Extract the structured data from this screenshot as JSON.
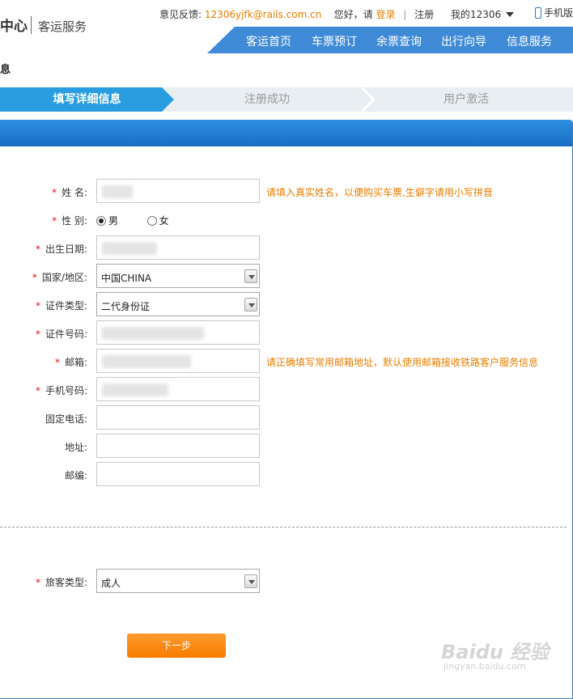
{
  "header": {
    "logo_fragment": "中心",
    "site_section": "客运服务",
    "feedback_label": "意见反馈:",
    "feedback_email": "12306yjfk@rails.com.cn",
    "greeting": "您好，请",
    "login": "登录",
    "separator": "|",
    "register": "注册",
    "my_account": "我的12306",
    "mobile": "手机版"
  },
  "nav": {
    "items": [
      "客运首页",
      "车票预订",
      "余票查询",
      "出行向导",
      "信息服务"
    ]
  },
  "page_heading_fragment": "息",
  "steps": [
    "填写详细信息",
    "注册成功",
    "用户激活"
  ],
  "form": {
    "name_label": "姓  名:",
    "name_hint": "请填入真实姓名，以便购买车票,生僻字请用小写拼音",
    "gender_label": "性  别:",
    "gender_male": "男",
    "gender_female": "女",
    "gender_selected": "男",
    "birth_label": "出生日期:",
    "country_label": "国家/地区:",
    "country_value": "中国CHINA",
    "idtype_label": "证件类型:",
    "idtype_value": "二代身份证",
    "idnum_label": "证件号码:",
    "email_label": "邮箱:",
    "email_hint": "请正确填写常用邮箱地址，默认使用邮箱接收铁路客户服务信息",
    "mobile_label": "手机号码:",
    "phone_label": "固定电话:",
    "address_label": "地址:",
    "zip_label": "邮编:",
    "passenger_label": "旅客类型:",
    "passenger_value": "成人",
    "required_mark": "*",
    "next_button": "下一步"
  },
  "watermark": {
    "main": "Baidu 经验",
    "sub": "jingyan.baidu.com"
  },
  "colors": {
    "accent_blue": "#3f8ad6",
    "step_active": "#2a9de0",
    "hint_orange": "#e87d00",
    "required_red": "#e0101a",
    "button_orange": "#f77d00"
  }
}
